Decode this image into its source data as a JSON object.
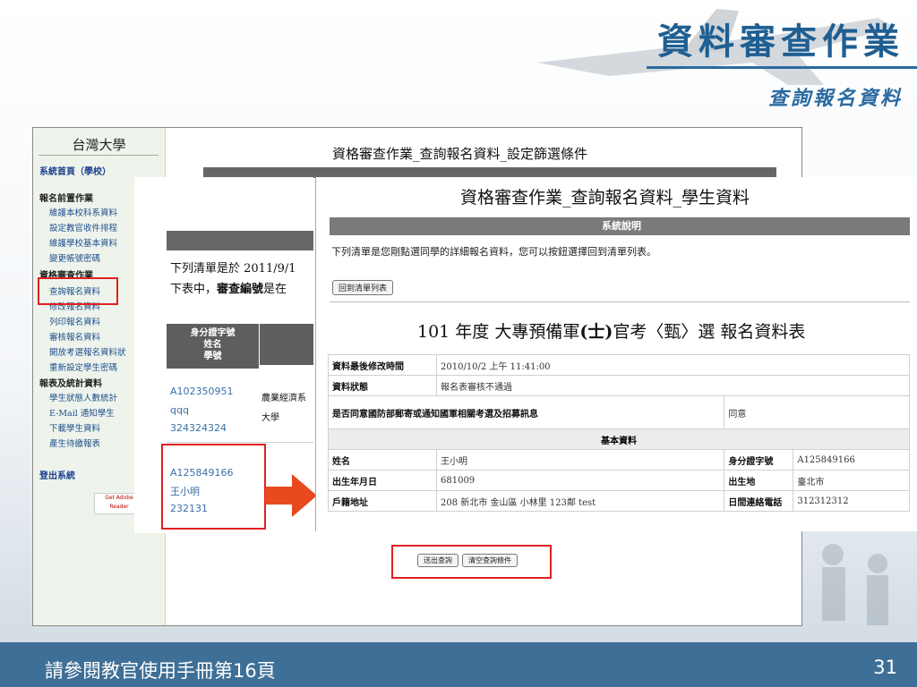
{
  "slide": {
    "title": "資料審查作業",
    "subtitle": "查詢報名資料",
    "footer": "請參閱教官使用手冊第16頁",
    "page_number": "31"
  },
  "sidebar": {
    "school": "台灣大學",
    "home": "系統首頁（學校）",
    "section1": "報名前置作業",
    "items1": [
      "維護本校科系資料",
      "設定教官收件排程",
      "維護學校基本資料",
      "變更帳號密碼"
    ],
    "section2": "資格審查作業",
    "items2": [
      "查詢報名資料",
      "修改報名資料",
      "列印報名資料",
      "審核報名資料",
      "開放考選報名資料狀",
      "重新設定學生密碼"
    ],
    "section3": "報表及統計資料",
    "items3": [
      "學生狀態人數統計",
      "E-Mail 通知學生",
      "下載學生資料",
      "產生待繳報表"
    ],
    "logout": "登出系統",
    "reader_label": "Get Adobe Reader"
  },
  "back_page": {
    "title": "資格審查作業_查詢報名資料_設定篩選條件",
    "query_button": "送出查詢",
    "clear_button": "清空查詢條件",
    "list_line1": "下列清單是於 2011/9/1",
    "list_line2_prefix": "下表中，",
    "list_line2_bold": "審查編號",
    "list_line2_suffix": "是在",
    "header_col1": [
      "身分證字號",
      "姓名",
      "學號"
    ],
    "rows": [
      {
        "id": "A102350951",
        "name": "qqq",
        "student_no": "324324324",
        "dept": "農業經濟系",
        "dept2": "大學"
      },
      {
        "id": "A125849166",
        "name": "王小明",
        "student_no": "232131"
      }
    ]
  },
  "front_page": {
    "title": "資格審查作業_查詢報名資料_學生資料",
    "system_note_header": "系統說明",
    "system_note": "下列清單是您剛點選同學的詳細報名資料，您可以按鈕選擇回到清單列表。",
    "back_button": "回到清單列表",
    "form_title_prefix": "101 年度 大專預備軍",
    "form_title_paren": "(士)",
    "form_title_suffix": "官考〈甄〉選 報名資料表",
    "last_modified_label": "資料最後修改時間",
    "last_modified": "2010/10/2 上午 11:41:00",
    "status_label": "資料狀態",
    "status": "報名表審核不通過",
    "consent_label": "是否同意國防部郵寄或通知國軍相關考選及招募訊息",
    "consent": "同意",
    "basic_section": "基本資料",
    "name_label": "姓名",
    "name": "王小明",
    "id_label": "身分證字號",
    "id": "A125849166",
    "birth_label": "出生年月日",
    "birth": "681009",
    "birthplace_label": "出生地",
    "birthplace": "臺北市",
    "address_label": "戶籍地址",
    "address": "208 新北市 金山區 小林里 123鄰 test",
    "phone_label": "日間連絡電話",
    "phone": "312312312"
  }
}
